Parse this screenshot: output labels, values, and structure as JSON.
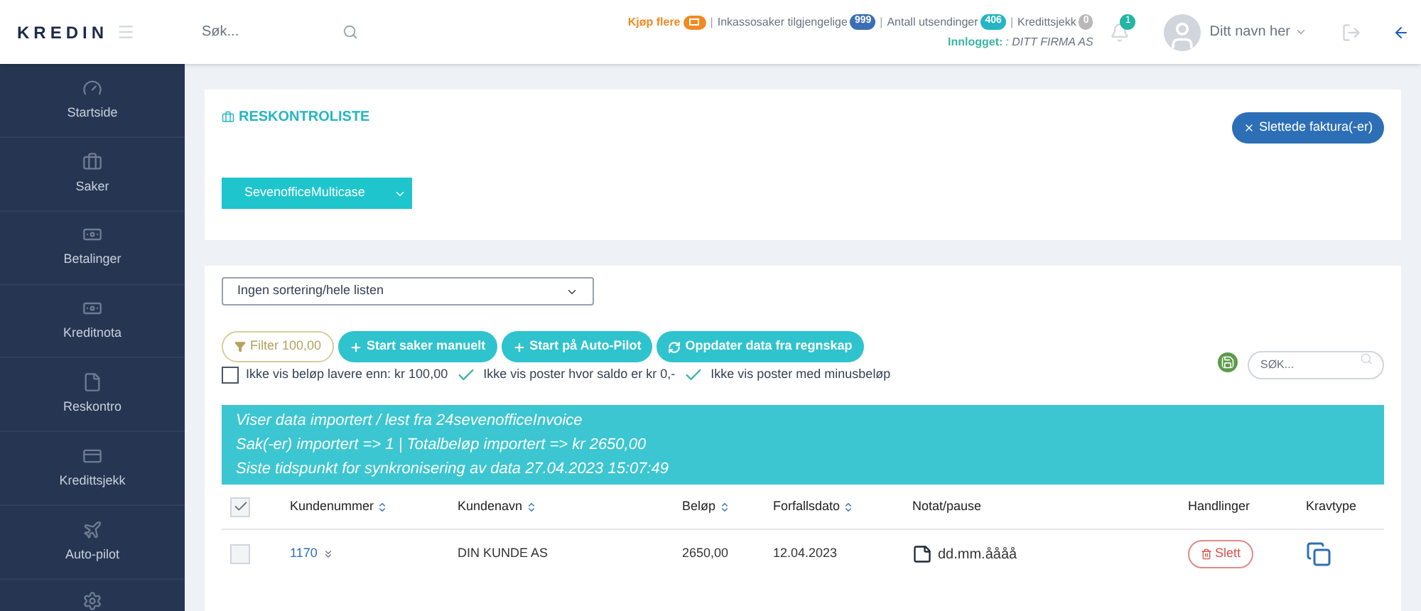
{
  "header": {
    "logo": "KREDIN",
    "search": {
      "placeholder": "Søk..."
    },
    "separator": "|",
    "counters": [
      {
        "label": "Kjøp flere",
        "color": "#f08a24",
        "kind": "buy"
      },
      {
        "label": "Inkassosaker tilgjengelige",
        "badge": "999",
        "color": "#3a6fb5",
        "kind": "count"
      },
      {
        "label": "Antall utsendinger",
        "badge": "406",
        "color": "#25b5c4",
        "kind": "count"
      },
      {
        "label": "Kredittsjekk",
        "badge": "0",
        "color": "#b8b8b8",
        "kind": "count"
      }
    ],
    "logged_in_label": "Innlogget:",
    "company": ": DITT FIRMA AS",
    "notifications": "1",
    "user": "Ditt navn her"
  },
  "sidebar": {
    "items": [
      {
        "label": "Startside",
        "selected": false
      },
      {
        "label": "Saker",
        "selected": false
      },
      {
        "label": "Betalinger",
        "selected": false
      },
      {
        "label": "Kreditnota",
        "selected": false
      },
      {
        "label": "Reskontro",
        "selected": false
      },
      {
        "label": "Kredittsjekk",
        "selected": false
      },
      {
        "label": "Auto-pilot",
        "selected": false
      }
    ]
  },
  "panel": {
    "title": "RESKONTROLISTE",
    "deleted_button": "Slettede faktura(-er)",
    "source": "SevenofficeMulticase"
  },
  "list": {
    "sort": "Ingen sortering/hele listen",
    "buttons": [
      {
        "label": "Filter 100,00",
        "kind": "filter"
      },
      {
        "label": "Start saker manuelt",
        "kind": "add"
      },
      {
        "label": "Start på Auto-Pilot",
        "kind": "add"
      },
      {
        "label": "Oppdater data fra regnskap",
        "kind": "refresh"
      }
    ],
    "search": {
      "placeholder": "SØK..."
    },
    "options": [
      {
        "label": "Ikke vis beløp lavere enn: kr 100,00",
        "checked": false
      },
      {
        "label": "Ikke vis poster hvor saldo er kr 0,-",
        "checked": true
      },
      {
        "label": "Ikke vis poster med minusbeløp",
        "checked": true
      }
    ],
    "info": [
      "Viser data importert / lest fra 24sevenofficeInvoice",
      "Sak(-er) importert => 1 | Totalbeløp importert => kr 2650,00",
      "Siste tidspunkt for synkronisering av data 27.04.2023 15:07:49"
    ],
    "table": {
      "all_checked": true,
      "columns": [
        {
          "label": "Kundenummer",
          "sortable": true
        },
        {
          "label": "Kundenavn",
          "sortable": true
        },
        {
          "label": "Beløp",
          "sortable": true
        },
        {
          "label": "Forfallsdato",
          "sortable": true
        },
        {
          "label": "Notat/pause",
          "sortable": false
        },
        {
          "label": "Handlinger",
          "sortable": false
        },
        {
          "label": "Kravtype",
          "sortable": false
        }
      ],
      "rows": [
        {
          "checked": false,
          "customer_number": "1170",
          "customer_name": "DIN KUNDE AS",
          "amount": "2650,00",
          "due_date": "12.04.2023",
          "note": "dd.mm.åååå",
          "action": "Slett"
        }
      ]
    }
  }
}
